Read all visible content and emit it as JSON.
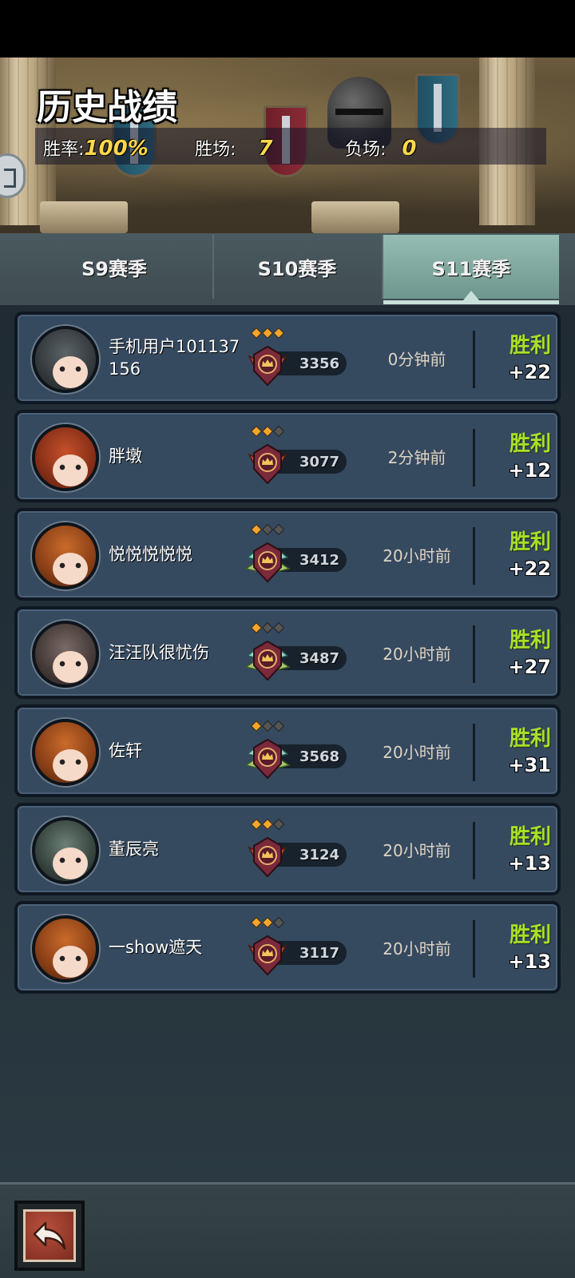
{
  "header": {
    "title": "历史战绩",
    "win_rate_label": "胜率:",
    "win_rate_value": "100%",
    "wins_label": "胜场:",
    "wins_value": "7",
    "losses_label": "负场:",
    "losses_value": "0"
  },
  "tabs": [
    {
      "label": "S9赛季",
      "active": false
    },
    {
      "label": "S10赛季",
      "active": false
    },
    {
      "label": "S11赛季",
      "active": true
    }
  ],
  "matches": [
    {
      "name": "手机用户101137156",
      "avatar": "bear-hat-avatar",
      "tier": "red",
      "pips": 3,
      "score": "3356",
      "time": "0分钟前",
      "result": "胜利",
      "delta": "+22"
    },
    {
      "name": "胖墩",
      "avatar": "red-mask-avatar",
      "tier": "red",
      "pips": 2,
      "score": "3077",
      "time": "2分钟前",
      "result": "胜利",
      "delta": "+12"
    },
    {
      "name": "悦悦悦悦悦",
      "avatar": "pumpkin-avatar",
      "tier": "winged",
      "pips": 1,
      "score": "3412",
      "time": "20小时前",
      "result": "胜利",
      "delta": "+22"
    },
    {
      "name": "汪汪队很忧伤",
      "avatar": "dog-hat-avatar",
      "tier": "winged",
      "pips": 1,
      "score": "3487",
      "time": "20小时前",
      "result": "胜利",
      "delta": "+27"
    },
    {
      "name": "佐轩",
      "avatar": "pumpkin-avatar",
      "tier": "winged",
      "pips": 1,
      "score": "3568",
      "time": "20小时前",
      "result": "胜利",
      "delta": "+31"
    },
    {
      "name": "董辰亮",
      "avatar": "goggles-avatar",
      "tier": "red",
      "pips": 2,
      "score": "3124",
      "time": "20小时前",
      "result": "胜利",
      "delta": "+13"
    },
    {
      "name": "一show遮天",
      "avatar": "pumpkin-avatar",
      "tier": "red",
      "pips": 2,
      "score": "3117",
      "time": "20小时前",
      "result": "胜利",
      "delta": "+13"
    }
  ],
  "footer": {
    "back_icon": "back-arrow-icon"
  },
  "colors": {
    "win": "#a8e028",
    "stat_value": "#ffd84a",
    "row_bg": "#35495f",
    "active_tab": "#96bdb3"
  }
}
